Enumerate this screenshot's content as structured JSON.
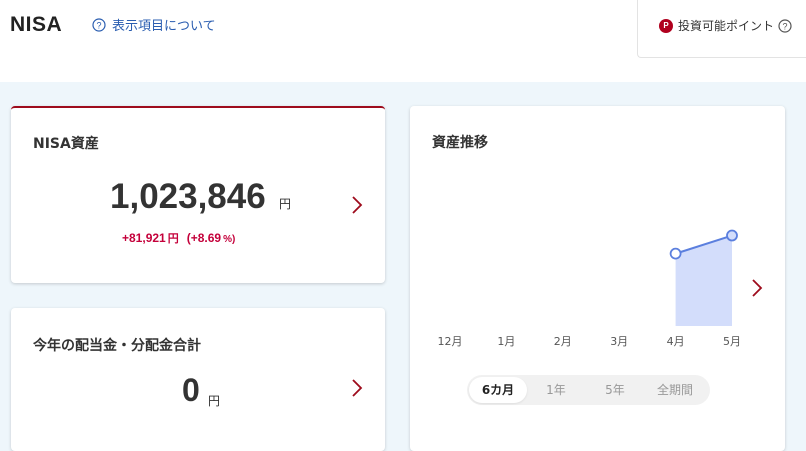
{
  "header": {
    "title": "NISA",
    "help_link": "表示項目について",
    "points_badge": "P",
    "points_label": "投資可能ポイント"
  },
  "assets_card": {
    "title": "NISA資産",
    "value": "1,023,846",
    "unit": "円",
    "change_value": "+81,921",
    "change_unit": "円",
    "change_pct": "(+8.69",
    "change_pct_unit": "%)"
  },
  "dividend_card": {
    "title": "今年の配当金・分配金合計",
    "value": "0",
    "unit": "円"
  },
  "trend_card": {
    "title": "資産推移",
    "tabs": [
      {
        "label": "6カ月",
        "active": true
      },
      {
        "label": "1年",
        "active": false
      },
      {
        "label": "5年",
        "active": false
      },
      {
        "label": "全期間",
        "active": false
      }
    ]
  },
  "chart_data": {
    "type": "area",
    "categories": [
      "12月",
      "1月",
      "2月",
      "3月",
      "4月",
      "5月"
    ],
    "values": [
      null,
      null,
      null,
      null,
      0.8,
      1.0
    ],
    "ylim": [
      0,
      1.05
    ],
    "grid": false,
    "legend": "none",
    "color": "#5b7fde",
    "fill": "#d3ddfb"
  },
  "colors": {
    "accent": "#9e0b1c",
    "positive_change": "#c4003a",
    "link": "#2a5db0",
    "background": "#eef6fb"
  }
}
